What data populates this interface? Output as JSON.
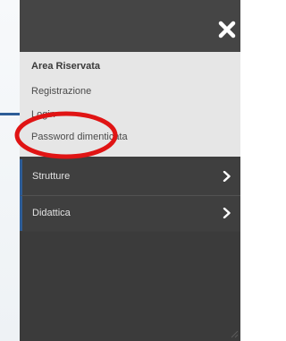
{
  "area": {
    "title": "Area Riservata",
    "links": [
      "Registrazione",
      "Login",
      "Password dimenticata"
    ]
  },
  "nav": {
    "items": [
      "Strutture",
      "Didattica"
    ]
  },
  "icons": {
    "close": "close-icon",
    "chevron": "chevron-right-icon"
  },
  "colors": {
    "accent": "#2e5d97",
    "annotation": "#e01414",
    "drawer": "#3d3d3d",
    "panel": "#e6e6e6"
  }
}
